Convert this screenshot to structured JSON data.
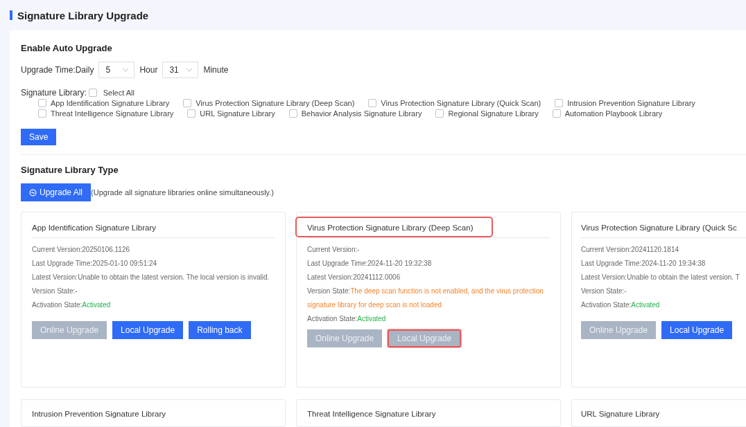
{
  "page_title": "Signature Library Upgrade",
  "auto_upgrade": {
    "heading": "Enable Auto Upgrade",
    "time_label": "Upgrade Time:Daily",
    "hour_value": "5",
    "hour_label": "Hour",
    "minute_value": "31",
    "minute_label": "Minute",
    "library_label": "Signature Library:",
    "select_all": {
      "label": "Select All",
      "checked": false
    },
    "library_rows": [
      {
        "items": [
          {
            "label": "App Identification Signature Library",
            "checked": false
          },
          {
            "label": "Virus Protection Signature Library (Deep Scan)",
            "checked": false
          },
          {
            "label": "Virus Protection Signature Library (Quick Scan)",
            "checked": false
          },
          {
            "label": "Intrusion Prevention Signature Library",
            "checked": false
          }
        ]
      },
      {
        "items": [
          {
            "label": "Threat Intelligence Signature Library",
            "checked": false
          },
          {
            "label": "URL Signature Library",
            "checked": false
          },
          {
            "label": "Behavior Analysis Signature Library",
            "checked": false
          },
          {
            "label": "Regional Signature Library",
            "checked": false
          },
          {
            "label": "Automation Playbook Library",
            "checked": false
          }
        ]
      }
    ],
    "save_button": "Save"
  },
  "library_types": {
    "heading": "Signature Library Type",
    "upgrade_all_button": "Upgrade All",
    "upgrade_all_note": "(Upgrade all signature libraries online simultaneously.)",
    "cards": [
      {
        "title": "App Identification Signature Library",
        "highlighted": false,
        "fields": [
          {
            "label": "Current Version:",
            "value": "20250106.1126"
          },
          {
            "label": "Last Upgrade Time:",
            "value": "2025-01-10 09:51:24"
          },
          {
            "label": "Latest Version:",
            "value": "Unable to obtain the latest version. The local version is invalid."
          },
          {
            "label": "Version State:",
            "value": "-"
          },
          {
            "label": "Activation State:",
            "value": "Activated",
            "color": "#22b04a"
          }
        ],
        "buttons": [
          {
            "label": "Online Upgrade",
            "disabled": true,
            "highlighted": false
          },
          {
            "label": "Local Upgrade",
            "disabled": false,
            "highlighted": false
          },
          {
            "label": "Rolling back",
            "disabled": false,
            "highlighted": false
          }
        ]
      },
      {
        "title": "Virus Protection Signature Library (Deep Scan)",
        "highlighted": true,
        "fields": [
          {
            "label": "Current Version:",
            "value": "-"
          },
          {
            "label": "Last Upgrade Time:",
            "value": "2024-11-20 19:32:38"
          },
          {
            "label": "Latest Version:",
            "value": "20241112.0006"
          },
          {
            "label": "Version State:",
            "value": "The deep scan function is not enabled, and the virus protection signature library for deep scan is not loaded",
            "color": "#f5822a"
          },
          {
            "label": "Activation State:",
            "value": "Activated",
            "color": "#22b04a"
          }
        ],
        "buttons": [
          {
            "label": "Online Upgrade",
            "disabled": true,
            "highlighted": false
          },
          {
            "label": "Local Upgrade",
            "disabled": true,
            "highlighted": true
          }
        ]
      },
      {
        "title": "Virus Protection Signature Library (Quick Sc",
        "highlighted": false,
        "fields": [
          {
            "label": "Current Version:",
            "value": "20241120.1814"
          },
          {
            "label": "Last Upgrade Time:",
            "value": "2024-11-20 19:34:38"
          },
          {
            "label": "Latest Version:",
            "value": "Unable to obtain the latest version. T"
          },
          {
            "label": "Version State:",
            "value": "-"
          },
          {
            "label": "Activation State:",
            "value": "Activated",
            "color": "#22b04a"
          }
        ],
        "buttons": [
          {
            "label": "Online Upgrade",
            "disabled": true,
            "highlighted": false
          },
          {
            "label": "Local Upgrade",
            "disabled": false,
            "highlighted": false
          }
        ]
      }
    ],
    "more_cards": [
      {
        "title": "Intrusion Prevention Signature Library"
      },
      {
        "title": "Threat Intelligence Signature Library"
      },
      {
        "title": "URL Signature Library"
      }
    ]
  }
}
